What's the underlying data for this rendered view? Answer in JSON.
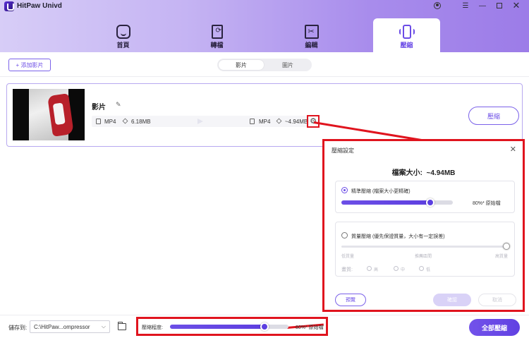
{
  "app": {
    "title": "HitPaw Univd"
  },
  "nav": {
    "tabs": [
      {
        "label": "首頁"
      },
      {
        "label": "轉檔"
      },
      {
        "label": "編輯"
      },
      {
        "label": "壓縮"
      }
    ],
    "active_tab": "壓縮"
  },
  "toolbar": {
    "add_label": "+ 添加影片",
    "segments": [
      "影片",
      "圖片"
    ]
  },
  "file": {
    "name": "影片",
    "input_format": "MP4",
    "input_size": "6.18MB",
    "output_format": "MP4",
    "output_size": "~4.94MB",
    "compress_label": "壓縮"
  },
  "settings": {
    "title": "壓縮設定",
    "size_label": "檔案大小:",
    "size_value": "~4.94MB",
    "option1": {
      "label": "精準壓縮 (檔案大小更精確)",
      "percent": "80%* 原始檔",
      "value": 80,
      "selected": true
    },
    "option2": {
      "label": "質量壓縮 (優先保證質量，大小有一定誤差)",
      "ticks": [
        "低質量",
        "推薦區間",
        "高質量"
      ],
      "quality_label": "畫質:",
      "quality_options": [
        "高",
        "中",
        "低"
      ],
      "selected": false
    },
    "buttons": {
      "preview": "預覽",
      "confirm": "確認",
      "cancel": "取消"
    }
  },
  "footer": {
    "save_label": "儲存到:",
    "path": "C:\\HitPaw...ompressor",
    "level_label": "壓縮程度:",
    "level_percent": "80%* 原始檔",
    "level_value": 80,
    "compress_all": "全部壓縮"
  },
  "colors": {
    "accent": "#6b4ce6",
    "highlight": "#e0141e"
  }
}
